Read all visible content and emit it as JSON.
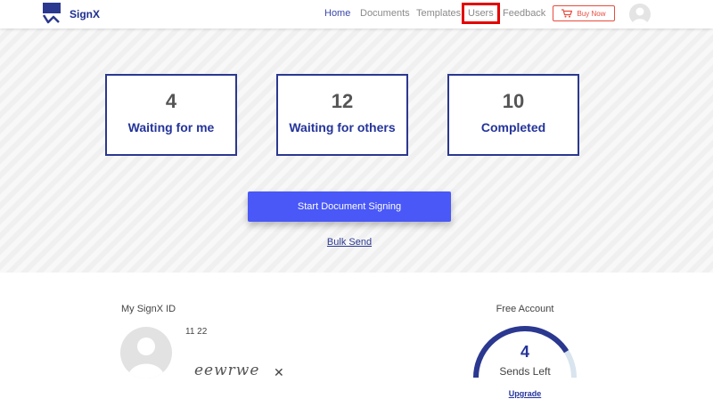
{
  "app": {
    "brand": "SignX"
  },
  "nav": {
    "items": [
      {
        "label": "Home",
        "active": true
      },
      {
        "label": "Documents",
        "active": false
      },
      {
        "label": "Templates",
        "active": false
      },
      {
        "label": "Users",
        "active": false
      },
      {
        "label": "Feedback",
        "active": false
      }
    ],
    "buy_now": "Buy Now",
    "highlight_color": "#e30000"
  },
  "stats": [
    {
      "value": "4",
      "label": "Waiting for me"
    },
    {
      "value": "12",
      "label": "Waiting for others"
    },
    {
      "value": "10",
      "label": "Completed"
    }
  ],
  "actions": {
    "start_signing": "Start Document Signing",
    "bulk_send": "Bulk Send"
  },
  "profile": {
    "id_label": "My SignX ID",
    "id_values": "11 22",
    "signature": "eewrwe",
    "remove_signature": "✕"
  },
  "account": {
    "type": "Free Account",
    "sends_left": "4",
    "sends_left_label": "Sends Left",
    "upgrade": "Upgrade",
    "gauge_fraction": 0.82
  },
  "colors": {
    "primary": "#24349a",
    "button": "#4958f7",
    "buy": "#e84c3d"
  },
  "icons": [
    "logo-icon",
    "cart-icon",
    "user-avatar-icon"
  ]
}
